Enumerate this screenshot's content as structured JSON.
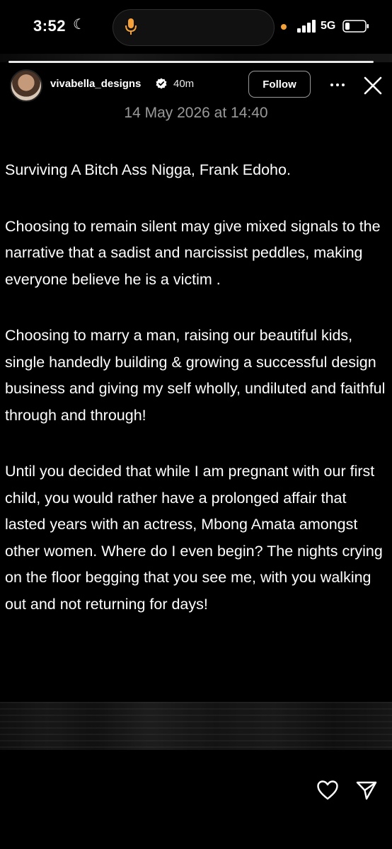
{
  "status_bar": {
    "time": "3:52",
    "network": "5G",
    "icons": [
      "moon-icon",
      "mic-icon",
      "signal-icon",
      "battery-icon"
    ],
    "accent_colors": {
      "mic": "#f5a13a",
      "recording_dot": "#f5a13a"
    }
  },
  "story": {
    "username": "vivabella_designs",
    "time_ago": "40m",
    "follow_label": "Follow",
    "icons": [
      "verified-icon",
      "more-icon",
      "close-icon"
    ]
  },
  "post": {
    "date": "14 May 2026 at 14:40",
    "paragraphs": [
      "Surviving A Bitch Ass Nigga, Frank Edoho.",
      "Choosing to remain silent may give mixed signals to the narrative that a sadist and narcissist peddles, making everyone believe he is a victim .",
      "Choosing to marry a man, raising our beautiful kids, single handedly building & growing a successful design business and giving my self wholly, undiluted and faithful through and through!",
      "Until you decided that while I am pregnant with our first child, you would rather have a prolonged affair that lasted years with an actress, Mbong Amata amongst other women. Where do I even begin? The nights crying on the floor begging that you see me, with you walking out and not returning for days!"
    ]
  },
  "footer": {
    "icons": [
      "heart-icon",
      "send-icon"
    ]
  }
}
